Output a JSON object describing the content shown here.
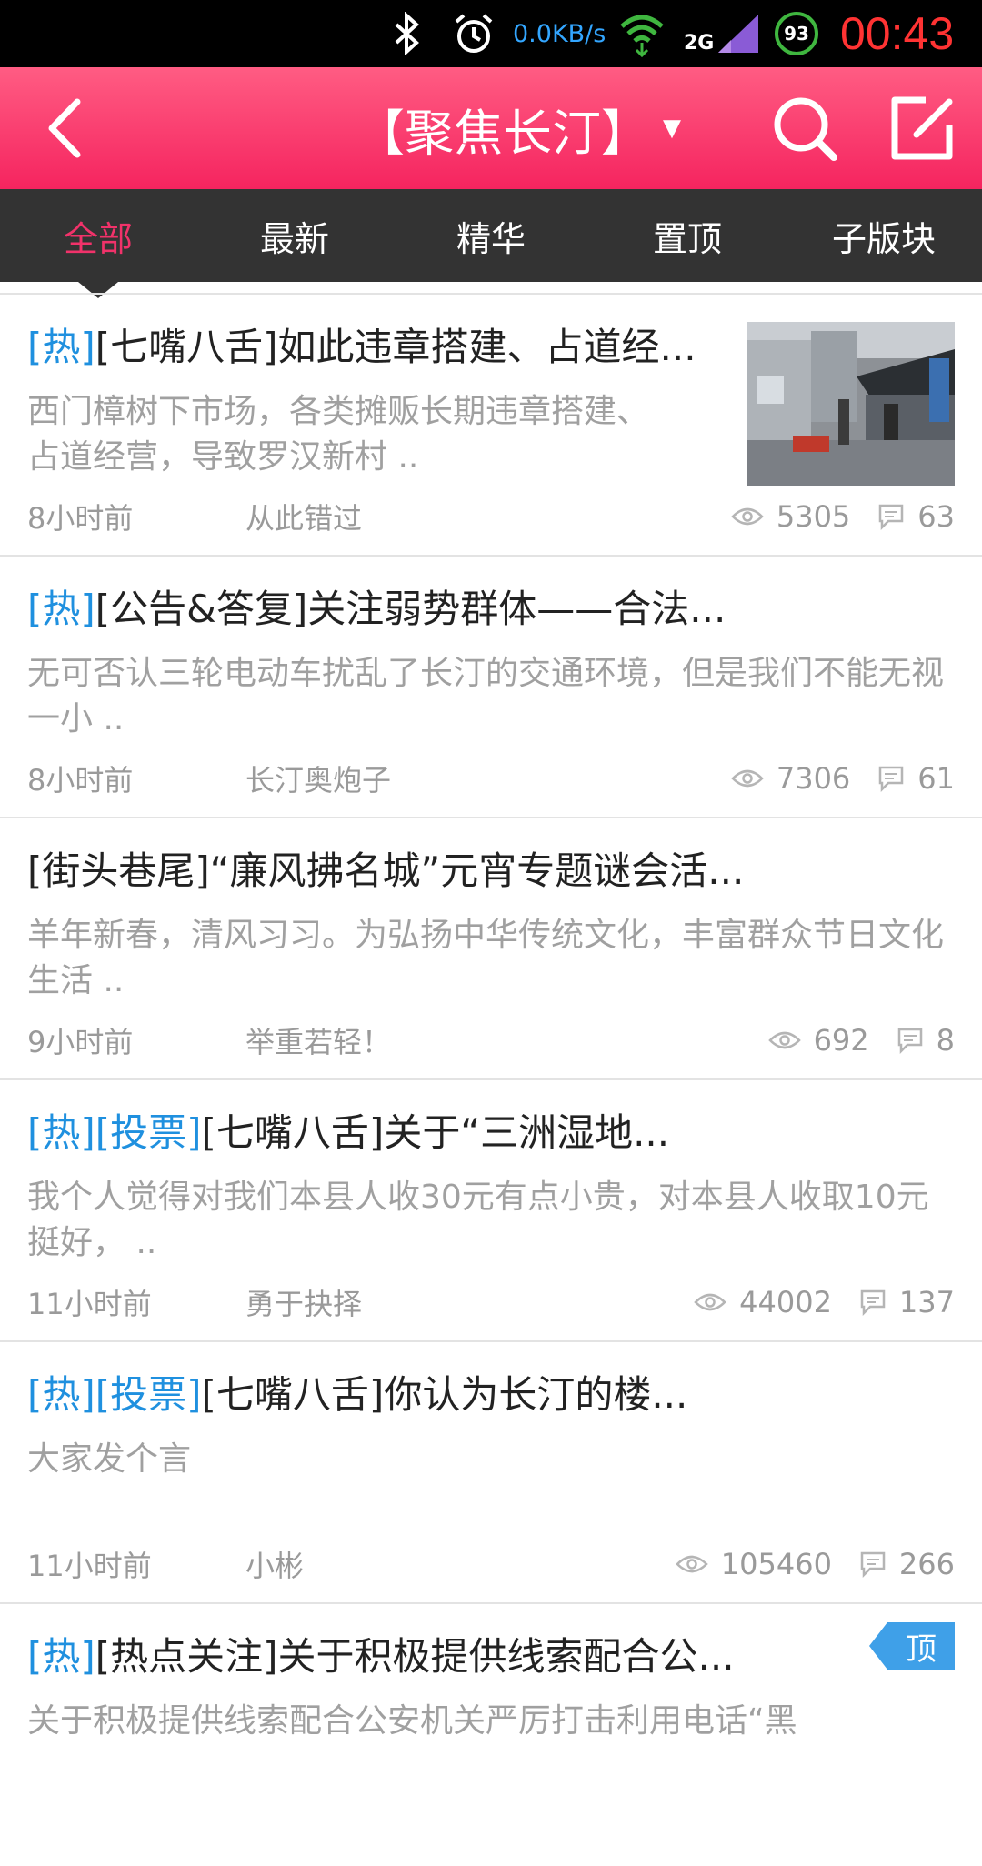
{
  "status_bar": {
    "network_speed": "0.0KB/s",
    "network_type": "2G",
    "battery": "93",
    "time": "00:43"
  },
  "header": {
    "title": "【聚焦长汀】",
    "icons": [
      "back-icon",
      "dropdown-caret-icon",
      "search-icon",
      "compose-icon"
    ]
  },
  "tabs": [
    {
      "label": "全部",
      "active": true
    },
    {
      "label": "最新",
      "active": false
    },
    {
      "label": "精华",
      "active": false
    },
    {
      "label": "置顶",
      "active": false
    },
    {
      "label": "子版块",
      "active": false
    }
  ],
  "posts": [
    {
      "tags": "[热]",
      "title": "[七嘴八舌]如此违章搭建、占道经...",
      "summary": "西门樟树下市场，各类摊贩长期违章搭建、占道经营，导致罗汉新村 ..",
      "time": "8小时前",
      "author": "从此错过",
      "views": "5305",
      "replies": "63"
    },
    {
      "tags": "[热]",
      "title": "[公告&答复]关注弱势群体——合法...",
      "summary": "无可否认三轮电动车扰乱了长汀的交通环境，但是我们不能无视一小 ..",
      "time": "8小时前",
      "author": "长汀奥炮子",
      "views": "7306",
      "replies": "61"
    },
    {
      "tags": "",
      "title": "[街头巷尾]“廉风拂名城”元宵专题谜会活...",
      "summary": "羊年新春，清风习习。为弘扬中华传统文化，丰富群众节日文化生活 ..",
      "time": "9小时前",
      "author": "举重若轻！",
      "views": "692",
      "replies": "8"
    },
    {
      "tags": "[热][投票]",
      "title": "[七嘴八舌]关于“三洲湿地...",
      "summary": "我个人觉得对我们本县人收30元有点小贵，对本县人收取10元挺好，  ..",
      "time": "11小时前",
      "author": "勇于抉择",
      "views": "44002",
      "replies": "137"
    },
    {
      "tags": "[热][投票]",
      "title": "[七嘴八舌]你认为长汀的楼...",
      "summary": "大家发个言",
      "time": "11小时前",
      "author": "小彬",
      "views": "105460",
      "replies": "266"
    },
    {
      "tags": "[热]",
      "title": "[热点关注]关于积极提供线索配合公...",
      "summary": "关于积极提供线索配合公安机关严厉打击利用电话“黑",
      "badge": "顶"
    }
  ]
}
